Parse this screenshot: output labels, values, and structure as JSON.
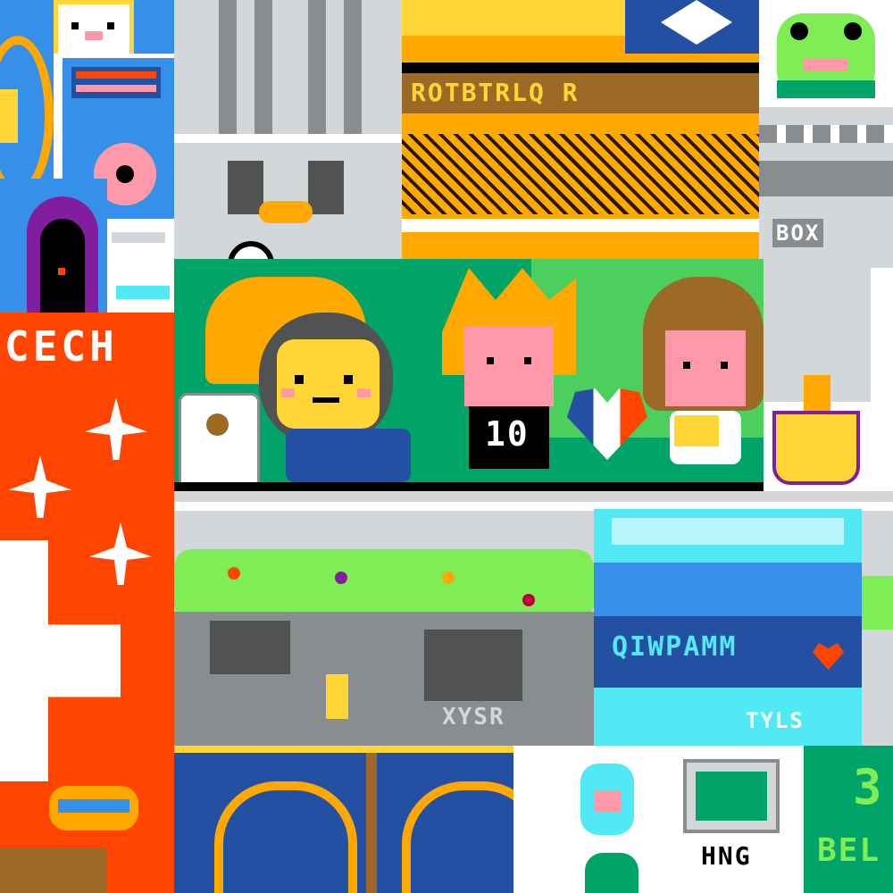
{
  "palette": {
    "white": "#ffffff",
    "black": "#000000",
    "blue": "#3690ea",
    "dark_blue": "#2450a4",
    "orange_red": "#ff4500",
    "gold": "#ffa800",
    "yellow": "#ffd635",
    "light_gray": "#d4d7d9",
    "gray": "#898d90",
    "dark_gray": "#515252",
    "green": "#00a368",
    "light_green": "#7eed56",
    "pink": "#ff99aa",
    "purple": "#811e9f",
    "light_blue": "#51e9f4",
    "brown": "#9c6926",
    "red": "#be0039"
  },
  "labels": {
    "cech": "CECH",
    "gold_bridge_banner": "ROTBTRLQ R",
    "sign_box": "BOX",
    "shirt_number": "10",
    "waterfall_text": "QIWPAMM",
    "waterfall_bottom_text": "TYLS",
    "cliff_text": "XYSR",
    "green_sign_digit": "3",
    "green_sign_text": "BEL",
    "cat_caption": "HNG"
  }
}
